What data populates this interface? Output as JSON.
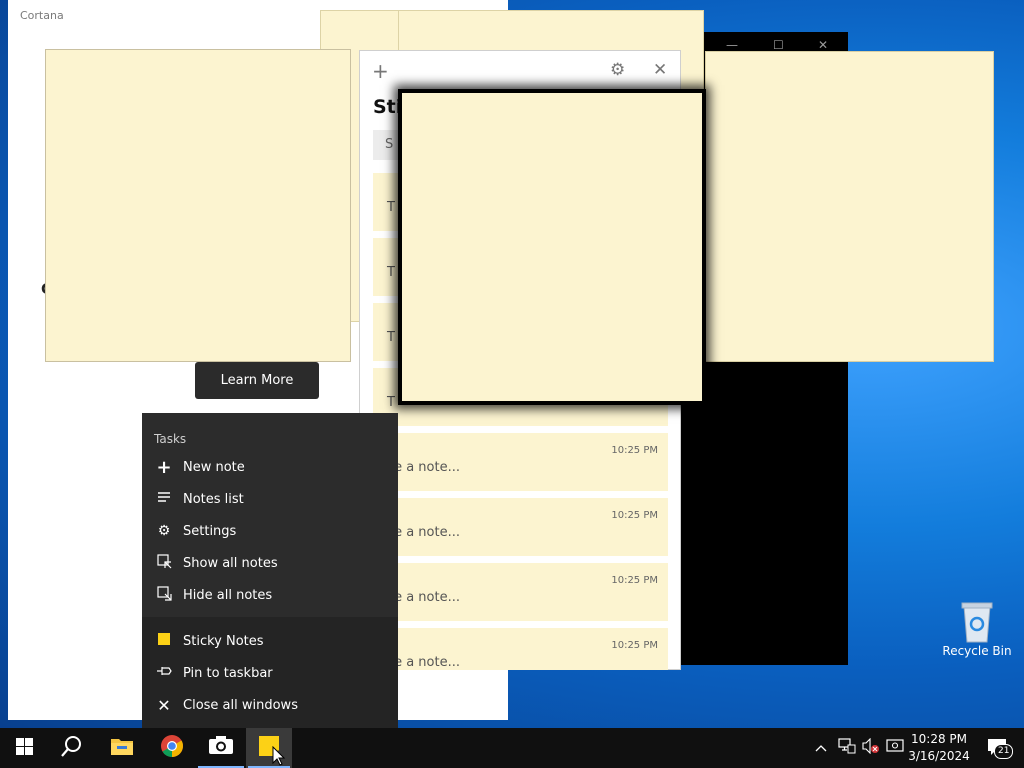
{
  "cortana": {
    "title": "Cortana",
    "partial_char": "C",
    "learn_more": "Learn More"
  },
  "sticky_list": {
    "add_icon": "+",
    "settings_icon": "⚙",
    "close_icon": "✕",
    "title_partial": "Sti",
    "search_partial": "S",
    "cards": [
      {
        "time": "",
        "text": "T"
      },
      {
        "time": "",
        "text": "T"
      },
      {
        "time": "",
        "text": "T"
      },
      {
        "time": "",
        "text": "T"
      },
      {
        "time": "10:25 PM",
        "text": "ke a note..."
      },
      {
        "time": "10:25 PM",
        "text": "ke a note..."
      },
      {
        "time": "10:25 PM",
        "text": "ke a note..."
      },
      {
        "time": "10:25 PM",
        "text": "ke a note..."
      }
    ]
  },
  "jumplist": {
    "section_label": "Tasks",
    "tasks": [
      {
        "icon": "plus-icon",
        "label": "New note"
      },
      {
        "icon": "list-icon",
        "label": "Notes list"
      },
      {
        "icon": "gear-icon",
        "label": "Settings"
      },
      {
        "icon": "show-notes-icon",
        "label": "Show all notes"
      },
      {
        "icon": "hide-notes-icon",
        "label": "Hide all notes"
      }
    ],
    "app": [
      {
        "icon": "sticky-notes-icon",
        "label": "Sticky Notes"
      },
      {
        "icon": "pin-icon",
        "label": "Pin to taskbar"
      },
      {
        "icon": "close-icon",
        "label": "Close all windows"
      }
    ]
  },
  "desktop": {
    "recycle_bin": "Recycle Bin"
  },
  "taskbar": {
    "time": "10:28 PM",
    "date": "3/16/2024",
    "notification_count": "21"
  },
  "colors": {
    "note": "#fcf4d0",
    "jumplist_bg": "#242424",
    "taskbar_bg": "#101010",
    "desktop": "#0a6fd1"
  }
}
